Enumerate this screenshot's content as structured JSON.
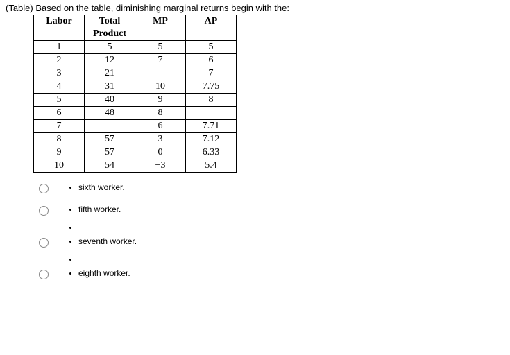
{
  "question_prefix": "(Table) Based on the table, diminishing marginal returns begin with the:",
  "headers": [
    "Labor",
    "Total Product",
    "MP",
    "AP"
  ],
  "header_labor": "Labor",
  "header_tp_line1": "Total",
  "header_tp_line2": "Product",
  "header_mp": "MP",
  "header_ap": "AP",
  "chart_data": {
    "type": "table",
    "columns": [
      "Labor",
      "Total Product",
      "MP",
      "AP"
    ],
    "rows": [
      {
        "labor": "1",
        "tp": "5",
        "mp": "5",
        "ap": "5"
      },
      {
        "labor": "2",
        "tp": "12",
        "mp": "7",
        "ap": "6"
      },
      {
        "labor": "3",
        "tp": "21",
        "mp": "",
        "ap": "7"
      },
      {
        "labor": "4",
        "tp": "31",
        "mp": "10",
        "ap": "7.75"
      },
      {
        "labor": "5",
        "tp": "40",
        "mp": "9",
        "ap": "8"
      },
      {
        "labor": "6",
        "tp": "48",
        "mp": "8",
        "ap": ""
      },
      {
        "labor": "7",
        "tp": "",
        "mp": "6",
        "ap": "7.71"
      },
      {
        "labor": "8",
        "tp": "57",
        "mp": "3",
        "ap": "7.12"
      },
      {
        "labor": "9",
        "tp": "57",
        "mp": "0",
        "ap": "6.33"
      },
      {
        "labor": "10",
        "tp": "54",
        "mp": "−3",
        "ap": "5.4"
      }
    ]
  },
  "options": [
    "sixth worker.",
    "fifth worker.",
    "seventh worker.",
    "eighth worker."
  ]
}
